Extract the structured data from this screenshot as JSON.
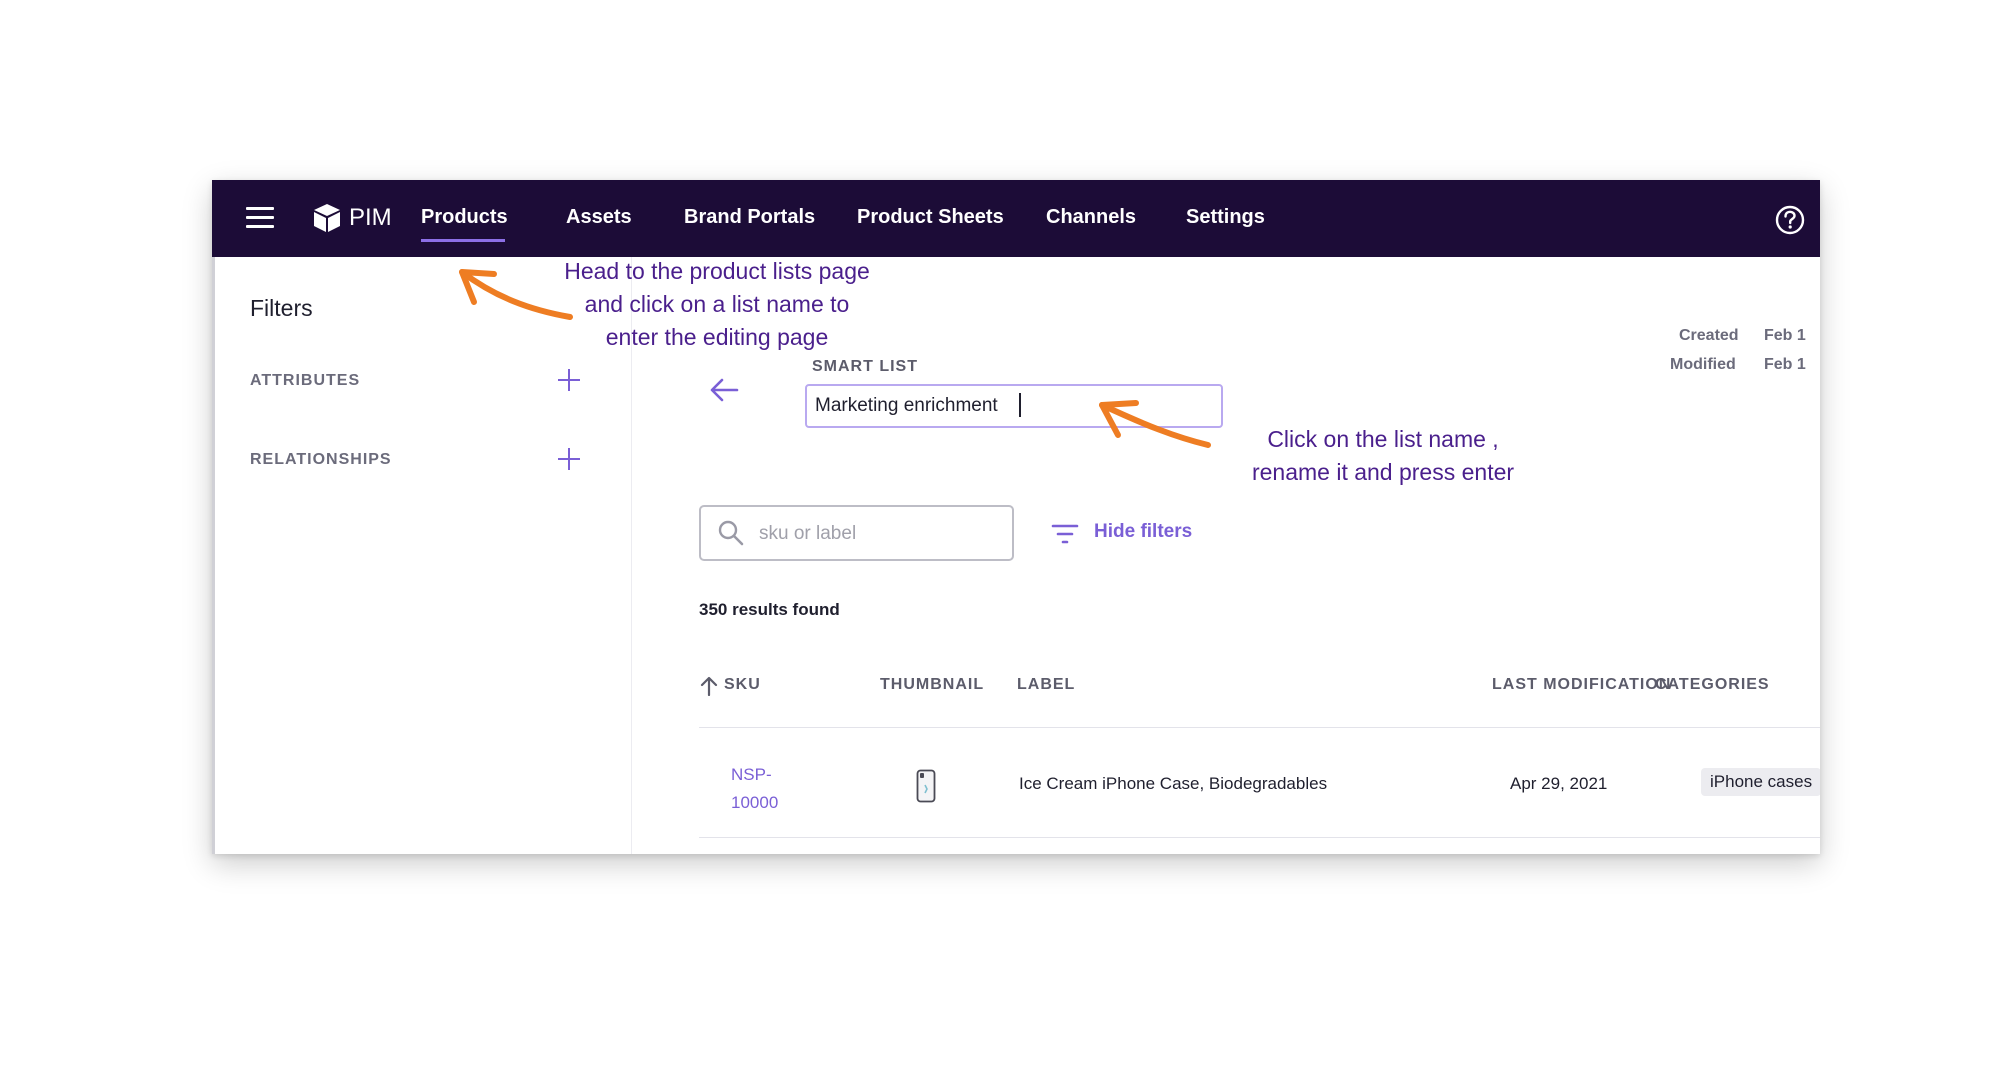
{
  "app": {
    "brand": "PIM"
  },
  "nav": {
    "items": [
      {
        "label": "Products",
        "active": true
      },
      {
        "label": "Assets"
      },
      {
        "label": "Brand Portals"
      },
      {
        "label": "Product Sheets"
      },
      {
        "label": "Channels"
      },
      {
        "label": "Settings"
      }
    ]
  },
  "sidebar": {
    "title": "Filters",
    "sections": [
      {
        "label": "ATTRIBUTES"
      },
      {
        "label": "RELATIONSHIPS"
      }
    ]
  },
  "meta": {
    "created_label": "Created",
    "created_value": "Feb 1",
    "modified_label": "Modified",
    "modified_value": "Feb 1"
  },
  "list": {
    "type_label": "SMART LIST",
    "name": "Marketing enrichment"
  },
  "search": {
    "placeholder": "sku or label",
    "value": ""
  },
  "filters_toggle": {
    "label": "Hide filters"
  },
  "results": {
    "text": "350 results found"
  },
  "table": {
    "columns": [
      "SKU",
      "THUMBNAIL",
      "LABEL",
      "LAST MODIFICATION",
      "CATEGORIES"
    ],
    "rows": [
      {
        "sku_line1": "NSP-",
        "sku_line2": "10000",
        "label": "Ice Cream iPhone Case, Biodegradables",
        "last_modification": "Apr 29, 2021",
        "category": "iPhone cases"
      }
    ]
  },
  "annotations": {
    "first": [
      "Head to the product lists page",
      "and click on a list name to",
      "enter the editing page"
    ],
    "second": [
      "Click on the list name ,",
      "rename it and press enter"
    ]
  },
  "colors": {
    "topbar": "#1c0c37",
    "accent": "#7a5fd6",
    "annotation_text": "#4a1f8c",
    "annotation_arrow": "#ee7d23"
  }
}
